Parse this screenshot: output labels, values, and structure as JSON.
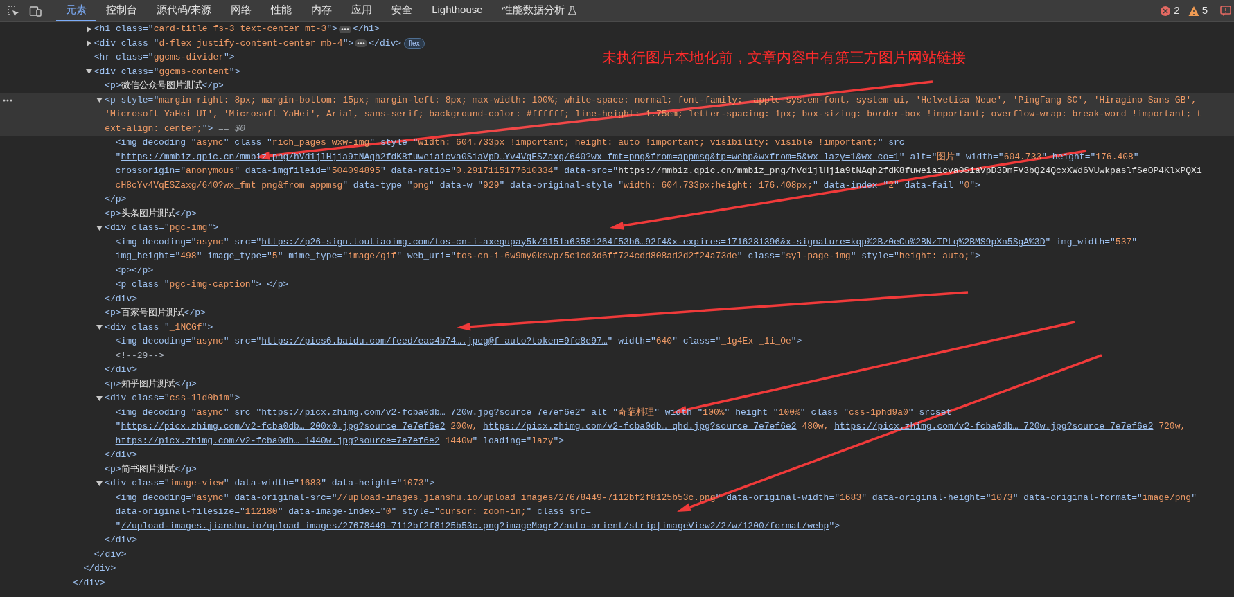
{
  "toolbar": {
    "tabs": [
      {
        "label": "元素",
        "selected": true,
        "experimental": false
      },
      {
        "label": "控制台",
        "selected": false,
        "experimental": false
      },
      {
        "label": "源代码/来源",
        "selected": false,
        "experimental": false
      },
      {
        "label": "网络",
        "selected": false,
        "experimental": false
      },
      {
        "label": "性能",
        "selected": false,
        "experimental": false
      },
      {
        "label": "内存",
        "selected": false,
        "experimental": false
      },
      {
        "label": "应用",
        "selected": false,
        "experimental": false
      },
      {
        "label": "安全",
        "selected": false,
        "experimental": false
      },
      {
        "label": "Lighthouse",
        "selected": false,
        "experimental": false
      },
      {
        "label": "性能数据分析",
        "selected": false,
        "experimental": true
      }
    ],
    "errors": "2",
    "warnings": "5"
  },
  "annotation": {
    "text": "未执行图片本地化前，文章内容中有第三方图片网站链接"
  },
  "dom": [
    {
      "close": [
        {
          "kind": "markup",
          "text": "</div>"
        }
      ],
      "children": [
        {
          "close": [
            {
              "kind": "markup",
              "text": "</div>"
            }
          ],
          "children": [
            {
              "selected": false,
              "expanded": false,
              "lines": [
                [
                  {
                    "kind": "markup",
                    "text": "<h1 class=\""
                  },
                  {
                    "kind": "value",
                    "text": "card-title fs-3 text-center mt-3"
                  },
                  {
                    "kind": "markup",
                    "text": "\">"
                  },
                  {
                    "kind": "dots"
                  },
                  {
                    "kind": "markup",
                    "text": "</h1>"
                  }
                ]
              ]
            },
            {
              "selected": false,
              "expanded": false,
              "lines": [
                [
                  {
                    "kind": "markup",
                    "text": "<div class=\""
                  },
                  {
                    "kind": "value",
                    "text": "d-flex justify-content-center mb-4"
                  },
                  {
                    "kind": "markup",
                    "text": "\">"
                  },
                  {
                    "kind": "dots"
                  },
                  {
                    "kind": "markup",
                    "text": "</div>"
                  },
                  {
                    "kind": "badge",
                    "text": "flex"
                  }
                ]
              ]
            },
            {
              "selected": false,
              "lines": [
                [
                  {
                    "kind": "markup",
                    "text": "<hr class=\""
                  },
                  {
                    "kind": "value",
                    "text": "ggcms-divider"
                  },
                  {
                    "kind": "markup",
                    "text": "\">"
                  }
                ]
              ]
            },
            {
              "selected": false,
              "expanded": true,
              "lines": [
                [
                  {
                    "kind": "markup",
                    "text": "<div class=\""
                  },
                  {
                    "kind": "value",
                    "text": "ggcms-content"
                  },
                  {
                    "kind": "markup",
                    "text": "\">"
                  }
                ]
              ],
              "close": [
                {
                  "kind": "markup",
                  "text": "</div>"
                }
              ],
              "children": [
                {
                  "selected": false,
                  "lines": [
                    [
                      {
                        "kind": "markup",
                        "text": "<p>"
                      },
                      {
                        "kind": "text",
                        "text": "微信公众号图片测试"
                      },
                      {
                        "kind": "markup",
                        "text": "</p>"
                      }
                    ]
                  ]
                },
                {
                  "selected": true,
                  "expanded": true,
                  "lines": [
                    [
                      {
                        "kind": "markup",
                        "text": "<p style=\""
                      },
                      {
                        "kind": "value",
                        "text": "margin-right: 8px; margin-bottom: 15px; margin-left: 8px; max-width: 100%; white-space: normal; font-family: -apple-system-font, system-ui, 'Helvetica Neue', 'PingFang SC', 'Hiragino Sans GB', "
                      }
                    ],
                    [
                      {
                        "kind": "value",
                        "text": "'Microsoft YaHei UI', 'Microsoft YaHei', Arial, sans-serif; background-color: #ffffff; line-height: 1.75em; letter-spacing: 1px; box-sizing: border-box !important; overflow-wrap: break-word !important; t"
                      }
                    ],
                    [
                      {
                        "kind": "value",
                        "text": "ext-align: center;"
                      },
                      {
                        "kind": "markup",
                        "text": "\">"
                      },
                      {
                        "kind": "hint",
                        "text": " == $0"
                      }
                    ]
                  ],
                  "close": [
                    {
                      "kind": "markup",
                      "text": "</p>"
                    }
                  ],
                  "children": [
                    {
                      "selected": false,
                      "lines": [
                        [
                          {
                            "kind": "markup",
                            "text": "<img decoding=\""
                          },
                          {
                            "kind": "value",
                            "text": "async"
                          },
                          {
                            "kind": "markup",
                            "text": "\" class=\""
                          },
                          {
                            "kind": "value",
                            "text": "rich_pages wxw-img"
                          },
                          {
                            "kind": "markup",
                            "text": "\" style=\""
                          },
                          {
                            "kind": "value",
                            "text": "width: 604.733px !important; height: auto !important; visibility: visible !important;"
                          },
                          {
                            "kind": "markup",
                            "text": "\" src="
                          }
                        ],
                        [
                          {
                            "kind": "markup",
                            "text": "\""
                          },
                          {
                            "kind": "link",
                            "text": "https://mmbiz.qpic.cn/mmbiz_png/hVd1jlHjia9tNAqh2fdK8fuweiaicva0SiaVpD…Yv4VqESZaxg/640?wx_fmt=png&from=appmsg&tp=webp&wxfrom=5&wx_lazy=1&wx_co=1"
                          },
                          {
                            "kind": "markup",
                            "text": "\" alt=\""
                          },
                          {
                            "kind": "value",
                            "text": "图片"
                          },
                          {
                            "kind": "markup",
                            "text": "\" width=\""
                          },
                          {
                            "kind": "value",
                            "text": "604.733"
                          },
                          {
                            "kind": "markup",
                            "text": "\" height=\""
                          },
                          {
                            "kind": "value",
                            "text": "176.408"
                          },
                          {
                            "kind": "markup",
                            "text": "\""
                          }
                        ],
                        [
                          {
                            "kind": "markup",
                            "text": "crossorigin=\""
                          },
                          {
                            "kind": "value",
                            "text": "anonymous"
                          },
                          {
                            "kind": "markup",
                            "text": "\" data-imgfileid=\""
                          },
                          {
                            "kind": "value",
                            "text": "504094895"
                          },
                          {
                            "kind": "markup",
                            "text": "\" data-ratio=\""
                          },
                          {
                            "kind": "value",
                            "text": "0.2917115177610334"
                          },
                          {
                            "kind": "markup",
                            "text": "\" data-src=\""
                          },
                          {
                            "kind": "text",
                            "text": "https://mmbiz.qpic.cn/mmbiz_png/hVd1jlHjia9tNAqh2fdK8fuweiaicva0SiaVpD3DmFV3bQ24QcxXWd6VUwkpaslfSeOP4KlxPQXi"
                          }
                        ],
                        [
                          {
                            "kind": "value",
                            "text": "cH8cYv4VqESZaxg/640?wx_fmt=png&from=appmsg"
                          },
                          {
                            "kind": "markup",
                            "text": "\" data-type=\""
                          },
                          {
                            "kind": "value",
                            "text": "png"
                          },
                          {
                            "kind": "markup",
                            "text": "\" data-w=\""
                          },
                          {
                            "kind": "value",
                            "text": "929"
                          },
                          {
                            "kind": "markup",
                            "text": "\" data-original-style=\""
                          },
                          {
                            "kind": "value",
                            "text": "width: 604.733px;height: 176.408px;"
                          },
                          {
                            "kind": "markup",
                            "text": "\" data-index=\""
                          },
                          {
                            "kind": "value",
                            "text": "2"
                          },
                          {
                            "kind": "markup",
                            "text": "\" data-fail=\""
                          },
                          {
                            "kind": "value",
                            "text": "0"
                          },
                          {
                            "kind": "markup",
                            "text": "\">"
                          }
                        ]
                      ]
                    }
                  ]
                },
                {
                  "selected": false,
                  "lines": [
                    [
                      {
                        "kind": "markup",
                        "text": "<p>"
                      },
                      {
                        "kind": "text",
                        "text": "头条图片测试"
                      },
                      {
                        "kind": "markup",
                        "text": "</p>"
                      }
                    ]
                  ]
                },
                {
                  "selected": false,
                  "expanded": true,
                  "lines": [
                    [
                      {
                        "kind": "markup",
                        "text": "<div class=\""
                      },
                      {
                        "kind": "value",
                        "text": "pgc-img"
                      },
                      {
                        "kind": "markup",
                        "text": "\">"
                      }
                    ]
                  ],
                  "close": [
                    {
                      "kind": "markup",
                      "text": "</div>"
                    }
                  ],
                  "children": [
                    {
                      "selected": false,
                      "lines": [
                        [
                          {
                            "kind": "markup",
                            "text": "<img decoding=\""
                          },
                          {
                            "kind": "value",
                            "text": "async"
                          },
                          {
                            "kind": "markup",
                            "text": "\" src=\""
                          },
                          {
                            "kind": "link",
                            "text": "https://p26-sign.toutiaoimg.com/tos-cn-i-axegupay5k/9151a63581264f53b6…92f4&x-expires=1716281396&x-signature=kqp%2Bz0eCu%2BNzTPLq%2BMS9pXn5SgA%3D"
                          },
                          {
                            "kind": "markup",
                            "text": "\" img_width=\""
                          },
                          {
                            "kind": "value",
                            "text": "537"
                          },
                          {
                            "kind": "markup",
                            "text": "\""
                          }
                        ],
                        [
                          {
                            "kind": "markup",
                            "text": "img_height=\""
                          },
                          {
                            "kind": "value",
                            "text": "498"
                          },
                          {
                            "kind": "markup",
                            "text": "\" image_type=\""
                          },
                          {
                            "kind": "value",
                            "text": "5"
                          },
                          {
                            "kind": "markup",
                            "text": "\" mime_type=\""
                          },
                          {
                            "kind": "value",
                            "text": "image/gif"
                          },
                          {
                            "kind": "markup",
                            "text": "\" web_uri=\""
                          },
                          {
                            "kind": "value",
                            "text": "tos-cn-i-6w9my0ksvp/5c1cd3d6ff724cdd808ad2d2f24a73de"
                          },
                          {
                            "kind": "markup",
                            "text": "\" class=\""
                          },
                          {
                            "kind": "value",
                            "text": "syl-page-img"
                          },
                          {
                            "kind": "markup",
                            "text": "\" style=\""
                          },
                          {
                            "kind": "value",
                            "text": "height: auto;"
                          },
                          {
                            "kind": "markup",
                            "text": "\">"
                          }
                        ]
                      ]
                    },
                    {
                      "selected": false,
                      "lines": [
                        [
                          {
                            "kind": "markup",
                            "text": "<p></p>"
                          }
                        ]
                      ]
                    },
                    {
                      "selected": false,
                      "lines": [
                        [
                          {
                            "kind": "markup",
                            "text": "<p class=\""
                          },
                          {
                            "kind": "value",
                            "text": "pgc-img-caption"
                          },
                          {
                            "kind": "markup",
                            "text": "\"> </p>"
                          }
                        ]
                      ]
                    }
                  ]
                },
                {
                  "selected": false,
                  "lines": [
                    [
                      {
                        "kind": "markup",
                        "text": "<p>"
                      },
                      {
                        "kind": "text",
                        "text": "百家号图片测试"
                      },
                      {
                        "kind": "markup",
                        "text": "</p>"
                      }
                    ]
                  ]
                },
                {
                  "selected": false,
                  "expanded": true,
                  "lines": [
                    [
                      {
                        "kind": "markup",
                        "text": "<div class=\""
                      },
                      {
                        "kind": "value",
                        "text": "_1NCGf"
                      },
                      {
                        "kind": "markup",
                        "text": "\">"
                      }
                    ]
                  ],
                  "close": [
                    {
                      "kind": "markup",
                      "text": "</div>"
                    }
                  ],
                  "children": [
                    {
                      "selected": false,
                      "lines": [
                        [
                          {
                            "kind": "markup",
                            "text": "<img decoding=\""
                          },
                          {
                            "kind": "value",
                            "text": "async"
                          },
                          {
                            "kind": "markup",
                            "text": "\" src=\""
                          },
                          {
                            "kind": "link",
                            "text": "https://pics6.baidu.com/feed/eac4b74….jpeg@f_auto?token=9fc8e97…"
                          },
                          {
                            "kind": "markup",
                            "text": "\" width=\""
                          },
                          {
                            "kind": "value",
                            "text": "640"
                          },
                          {
                            "kind": "markup",
                            "text": "\" class=\""
                          },
                          {
                            "kind": "value",
                            "text": "_1g4Ex _1i_Oe"
                          },
                          {
                            "kind": "markup",
                            "text": "\">"
                          }
                        ]
                      ]
                    },
                    {
                      "selected": false,
                      "lines": [
                        [
                          {
                            "kind": "comment",
                            "text": "<!--29-->"
                          }
                        ]
                      ]
                    }
                  ]
                },
                {
                  "selected": false,
                  "lines": [
                    [
                      {
                        "kind": "markup",
                        "text": "<p>"
                      },
                      {
                        "kind": "text",
                        "text": "知乎图片测试"
                      },
                      {
                        "kind": "markup",
                        "text": "</p>"
                      }
                    ]
                  ]
                },
                {
                  "selected": false,
                  "expanded": true,
                  "lines": [
                    [
                      {
                        "kind": "markup",
                        "text": "<div class=\""
                      },
                      {
                        "kind": "value",
                        "text": "css-1ld0bim"
                      },
                      {
                        "kind": "markup",
                        "text": "\">"
                      }
                    ]
                  ],
                  "close": [
                    {
                      "kind": "markup",
                      "text": "</div>"
                    }
                  ],
                  "children": [
                    {
                      "selected": false,
                      "lines": [
                        [
                          {
                            "kind": "markup",
                            "text": "<img decoding=\""
                          },
                          {
                            "kind": "value",
                            "text": "async"
                          },
                          {
                            "kind": "markup",
                            "text": "\" src=\""
                          },
                          {
                            "kind": "link",
                            "text": "https://picx.zhimg.com/v2-fcba0db…_720w.jpg?source=7e7ef6e2"
                          },
                          {
                            "kind": "markup",
                            "text": "\" alt=\""
                          },
                          {
                            "kind": "value",
                            "text": "奇葩料理"
                          },
                          {
                            "kind": "markup",
                            "text": "\" width=\""
                          },
                          {
                            "kind": "value",
                            "text": "100%"
                          },
                          {
                            "kind": "markup",
                            "text": "\" height=\""
                          },
                          {
                            "kind": "value",
                            "text": "100%"
                          },
                          {
                            "kind": "markup",
                            "text": "\" class=\""
                          },
                          {
                            "kind": "value",
                            "text": "css-1phd9a0"
                          },
                          {
                            "kind": "markup",
                            "text": "\" srcset="
                          }
                        ],
                        [
                          {
                            "kind": "markup",
                            "text": "\""
                          },
                          {
                            "kind": "link",
                            "text": "https://picx.zhimg.com/v2-fcba0db…_200x0.jpg?source=7e7ef6e2"
                          },
                          {
                            "kind": "value",
                            "text": " 200w, "
                          },
                          {
                            "kind": "link",
                            "text": "https://picx.zhimg.com/v2-fcba0db…_qhd.jpg?source=7e7ef6e2"
                          },
                          {
                            "kind": "value",
                            "text": " 480w, "
                          },
                          {
                            "kind": "link",
                            "text": "https://picx.zhimg.com/v2-fcba0db…_720w.jpg?source=7e7ef6e2"
                          },
                          {
                            "kind": "value",
                            "text": " 720w,"
                          }
                        ],
                        [
                          {
                            "kind": "link",
                            "text": "https://picx.zhimg.com/v2-fcba0db…_1440w.jpg?source=7e7ef6e2"
                          },
                          {
                            "kind": "value",
                            "text": " 1440w"
                          },
                          {
                            "kind": "markup",
                            "text": "\" loading=\""
                          },
                          {
                            "kind": "value",
                            "text": "lazy"
                          },
                          {
                            "kind": "markup",
                            "text": "\">"
                          }
                        ]
                      ]
                    }
                  ]
                },
                {
                  "selected": false,
                  "lines": [
                    [
                      {
                        "kind": "markup",
                        "text": "<p>"
                      },
                      {
                        "kind": "text",
                        "text": "简书图片测试"
                      },
                      {
                        "kind": "markup",
                        "text": "</p>"
                      }
                    ]
                  ]
                },
                {
                  "selected": false,
                  "expanded": true,
                  "lines": [
                    [
                      {
                        "kind": "markup",
                        "text": "<div class=\""
                      },
                      {
                        "kind": "value",
                        "text": "image-view"
                      },
                      {
                        "kind": "markup",
                        "text": "\" data-width=\""
                      },
                      {
                        "kind": "value",
                        "text": "1683"
                      },
                      {
                        "kind": "markup",
                        "text": "\" data-height=\""
                      },
                      {
                        "kind": "value",
                        "text": "1073"
                      },
                      {
                        "kind": "markup",
                        "text": "\">"
                      }
                    ]
                  ],
                  "close": [
                    {
                      "kind": "markup",
                      "text": "</div>"
                    }
                  ],
                  "children": [
                    {
                      "selected": false,
                      "lines": [
                        [
                          {
                            "kind": "markup",
                            "text": "<img decoding=\""
                          },
                          {
                            "kind": "value",
                            "text": "async"
                          },
                          {
                            "kind": "markup",
                            "text": "\" data-original-src=\""
                          },
                          {
                            "kind": "value",
                            "text": "//upload-images.jianshu.io/upload_images/27678449-7112bf2f8125b53c.png"
                          },
                          {
                            "kind": "markup",
                            "text": "\" data-original-width=\""
                          },
                          {
                            "kind": "value",
                            "text": "1683"
                          },
                          {
                            "kind": "markup",
                            "text": "\" data-original-height=\""
                          },
                          {
                            "kind": "value",
                            "text": "1073"
                          },
                          {
                            "kind": "markup",
                            "text": "\" data-original-format=\""
                          },
                          {
                            "kind": "value",
                            "text": "image/png"
                          },
                          {
                            "kind": "markup",
                            "text": "\""
                          }
                        ],
                        [
                          {
                            "kind": "markup",
                            "text": "data-original-filesize=\""
                          },
                          {
                            "kind": "value",
                            "text": "112180"
                          },
                          {
                            "kind": "markup",
                            "text": "\" data-image-index=\""
                          },
                          {
                            "kind": "value",
                            "text": "0"
                          },
                          {
                            "kind": "markup",
                            "text": "\" style=\""
                          },
                          {
                            "kind": "value",
                            "text": "cursor: zoom-in;"
                          },
                          {
                            "kind": "markup",
                            "text": "\" class src="
                          }
                        ],
                        [
                          {
                            "kind": "markup",
                            "text": "\""
                          },
                          {
                            "kind": "link",
                            "text": "//upload-images.jianshu.io/upload_images/27678449-7112bf2f8125b53c.png?imageMogr2/auto-orient/strip|imageView2/2/w/1200/format/webp"
                          },
                          {
                            "kind": "markup",
                            "text": "\">"
                          }
                        ]
                      ]
                    }
                  ]
                }
              ]
            }
          ]
        }
      ]
    }
  ]
}
